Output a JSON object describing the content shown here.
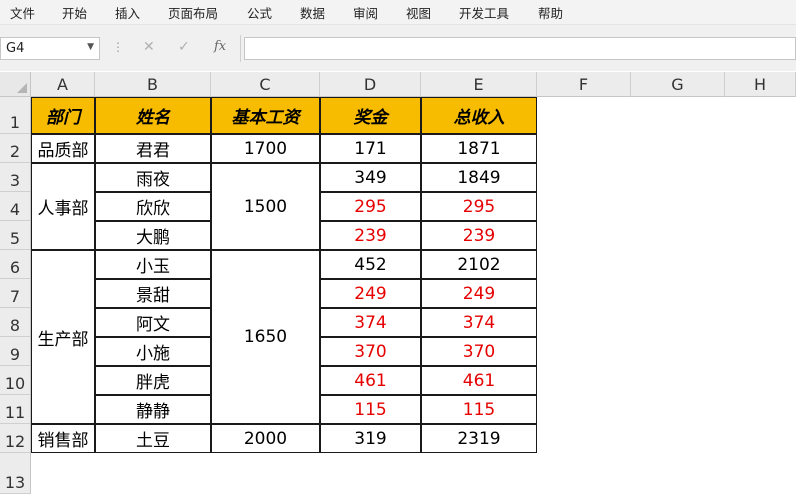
{
  "menu": [
    "文件",
    "开始",
    "插入",
    "页面布局",
    "公式",
    "数据",
    "审阅",
    "视图",
    "开发工具",
    "帮助"
  ],
  "formula_bar": {
    "name_box": "G4",
    "cancel_icon": "✕",
    "enter_icon": "✓",
    "fx_label": "fx",
    "formula": ""
  },
  "columns": [
    "A",
    "B",
    "C",
    "D",
    "E",
    "F",
    "G",
    "H"
  ],
  "rows": [
    "1",
    "2",
    "3",
    "4",
    "5",
    "6",
    "7",
    "8",
    "9",
    "10",
    "11",
    "12",
    "13"
  ],
  "table": {
    "headers": [
      "部门",
      "姓名",
      "基本工资",
      "奖金",
      "总收入"
    ],
    "departments": [
      {
        "name": "品质部",
        "base_salary": "1700"
      },
      {
        "name": "人事部",
        "base_salary": "1500"
      },
      {
        "name": "生产部",
        "base_salary": "1650"
      },
      {
        "name": "销售部",
        "base_salary": "2000"
      }
    ],
    "records": [
      {
        "name": "君君",
        "bonus": "171",
        "total": "1871"
      },
      {
        "name": "雨夜",
        "bonus": "349",
        "total": "1849"
      },
      {
        "name": "欣欣",
        "bonus": "295",
        "total": "295"
      },
      {
        "name": "大鹏",
        "bonus": "239",
        "total": "239"
      },
      {
        "name": "小玉",
        "bonus": "452",
        "total": "2102"
      },
      {
        "name": "景甜",
        "bonus": "249",
        "total": "249"
      },
      {
        "name": "阿文",
        "bonus": "374",
        "total": "374"
      },
      {
        "name": "小施",
        "bonus": "370",
        "total": "370"
      },
      {
        "name": "胖虎",
        "bonus": "461",
        "total": "461"
      },
      {
        "name": "静静",
        "bonus": "115",
        "total": "115"
      },
      {
        "name": "土豆",
        "bonus": "319",
        "total": "2319"
      }
    ]
  },
  "colors": {
    "header_fill": "#f7bb00",
    "red_text": "#e60000",
    "black_text": "#000000"
  },
  "highlighted_values": [
    {
      "record": "欣欣",
      "color": "red"
    },
    {
      "record": "大鹏",
      "color": "red"
    },
    {
      "record": "景甜",
      "color": "red"
    },
    {
      "record": "阿文",
      "color": "red"
    },
    {
      "record": "小施",
      "color": "red"
    },
    {
      "record": "胖虎",
      "color": "red"
    },
    {
      "record": "静静",
      "color": "red"
    }
  ]
}
